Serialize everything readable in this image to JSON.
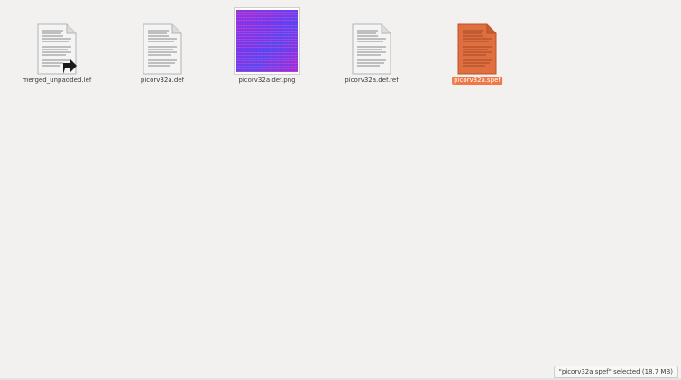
{
  "files": [
    {
      "name": "merged_unpadded.lef",
      "icon": "text-file-symlink-icon"
    },
    {
      "name": "picorv32a.def",
      "icon": "text-file-icon"
    },
    {
      "name": "picorv32a.def.png",
      "icon": "image-thumbnail"
    },
    {
      "name": "picorv32a.def.ref",
      "icon": "text-file-icon"
    },
    {
      "name": "picorv32a.spef",
      "icon": "text-file-selected-icon",
      "selected": true
    }
  ],
  "status": {
    "text": "\"picorv32a.spef\" selected",
    "size": "(18.7 MB)"
  },
  "colors": {
    "background": "#f2f1f0",
    "selection": "#f07746",
    "selected_icon": "#e06e3e"
  }
}
